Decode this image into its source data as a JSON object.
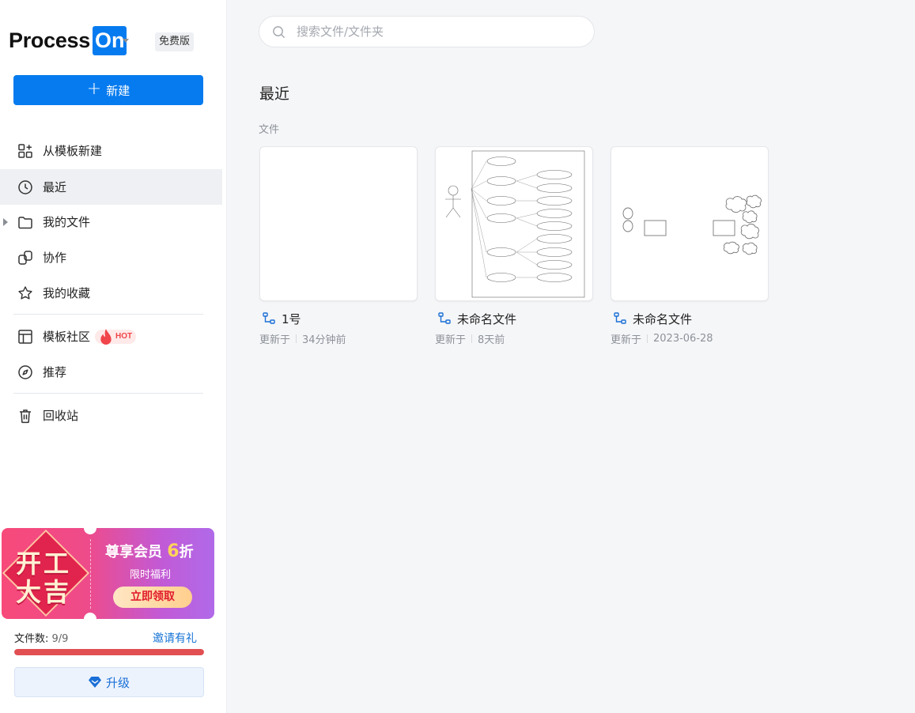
{
  "brand": {
    "name": "Process",
    "badge": "On",
    "plan": "免费版"
  },
  "new_button": {
    "icon": "plus-icon",
    "label": "新建"
  },
  "nav": {
    "from_template": "从模板新建",
    "recent": "最近",
    "my_files": "我的文件",
    "collab": "协作",
    "favorites": "我的收藏",
    "community": "模板社区",
    "community_tag": "HOT",
    "recommend": "推荐",
    "trash": "回收站"
  },
  "promo": {
    "big_line1": "开工",
    "big_line2": "大吉",
    "title": "尊享会员",
    "discount_num": "6",
    "discount_unit": "折",
    "subtitle": "限时福利",
    "button": "立即领取"
  },
  "quota": {
    "label": "文件数:",
    "value": "9/9",
    "fraction": 1.0,
    "bar_color": "#e14f52"
  },
  "invite": "邀请有礼",
  "upgrade": {
    "icon": "diamond-icon",
    "label": "升级"
  },
  "search": {
    "placeholder": "搜索文件/文件夹",
    "value": ""
  },
  "main": {
    "title": "最近",
    "section": "文件"
  },
  "files": [
    {
      "name": "1号",
      "meta_label": "更新于",
      "meta_value": "34分钟前",
      "icon": "flowchart-icon"
    },
    {
      "name": "未命名文件",
      "meta_label": "更新于",
      "meta_value": "8天前",
      "icon": "flowchart-icon"
    },
    {
      "name": "未命名文件",
      "meta_label": "更新于",
      "meta_value": "2023-06-28",
      "icon": "flowchart-icon"
    }
  ],
  "colors": {
    "accent": "#067bef",
    "active_bg": "#eef0f3",
    "hot": "#f0454a"
  }
}
